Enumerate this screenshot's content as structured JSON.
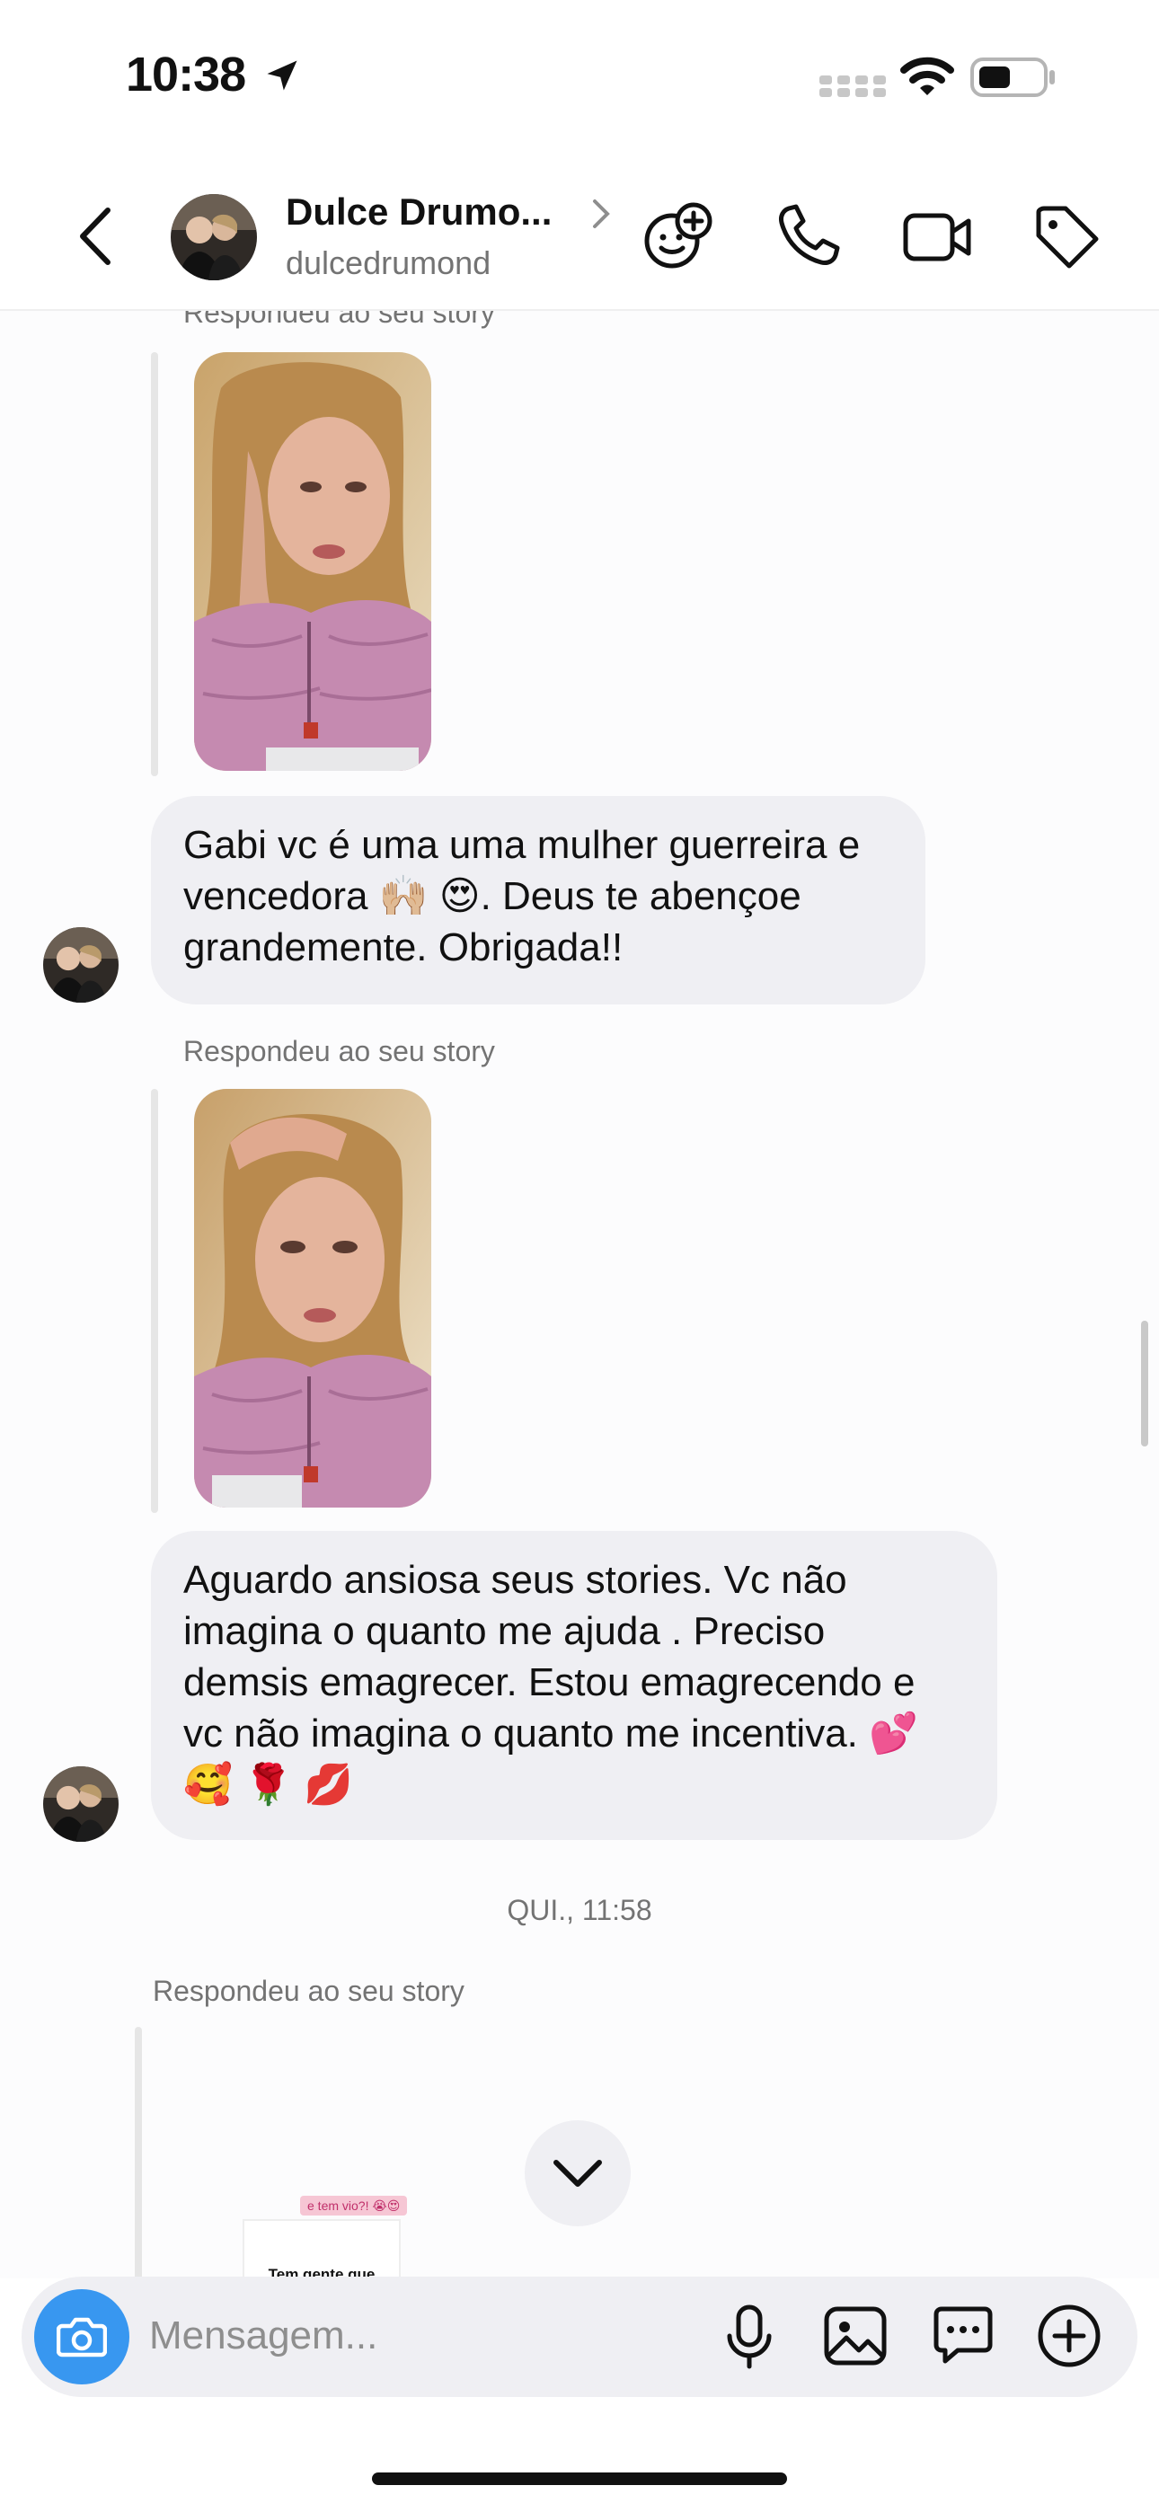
{
  "status_bar": {
    "time": "10:38"
  },
  "header": {
    "contact_name": "Dulce Drumo...",
    "contact_handle": "dulcedrumond"
  },
  "messages": [
    {
      "type": "story_reply",
      "meta": "Respondeu ao seu story",
      "text": "Gabi vc é uma uma mulher guerreira e\nvencedora 🙌🏼 😍. Deus te abençoe\ngrandemente. Obrigada!!"
    },
    {
      "type": "story_reply",
      "meta": "Respondeu ao seu story",
      "text": "Aguardo ansiosa seus stories. Vc não\nimagina o quanto me ajuda . Preciso\ndemsis emagrecer. Estou emagrecendo e\nvc não imagina o quanto me incentiva.  💕\n🥰 🌹 💋"
    }
  ],
  "day_stamp": "QUI., 11:58",
  "last_story": {
    "meta": "Respondeu ao seu story",
    "sticker_text": "e tem vio?! 😭😍",
    "card_text": "Tem gente que"
  },
  "composer": {
    "placeholder": "Mensagem..."
  },
  "colors": {
    "accent": "#3897f0",
    "bubble": "#efeff3",
    "meta": "#737373"
  }
}
